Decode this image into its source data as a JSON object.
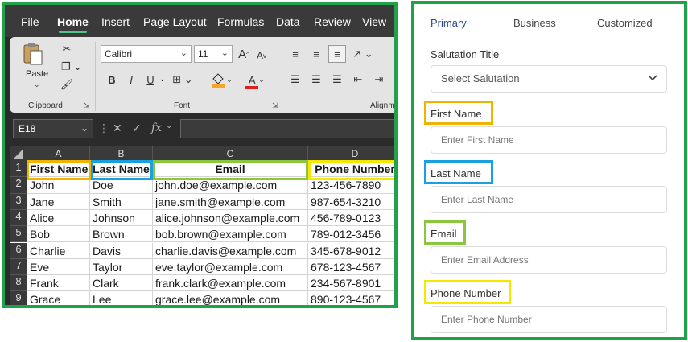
{
  "excel": {
    "menu": [
      "File",
      "Home",
      "Insert",
      "Page Layout",
      "Formulas",
      "Data",
      "Review",
      "View"
    ],
    "active_menu": "Home",
    "ribbon": {
      "paste_label": "Paste",
      "clipboard_label": "Clipboard",
      "font_name": "Calibri",
      "font_size": "11",
      "font_group_label": "Font",
      "alignment_label": "Alignme",
      "bold": "B",
      "italic": "I",
      "underline": "U",
      "grow_font": "A",
      "shrink_font": "A",
      "font_color_letter": "A"
    },
    "name_box": "E18",
    "formula_icons": {
      "cancel": "✕",
      "confirm": "✓",
      "fx": "fx"
    },
    "columns": [
      "A",
      "B",
      "C",
      "D"
    ],
    "rows": [
      "1",
      "2",
      "3",
      "4",
      "5",
      "6",
      "7",
      "8",
      "9"
    ],
    "header": [
      "First Name",
      "Last Name",
      "Email",
      "Phone Number"
    ],
    "data": [
      [
        "John",
        "Doe",
        "john.doe@example.com",
        "123-456-7890"
      ],
      [
        "Jane",
        "Smith",
        "jane.smith@example.com",
        "987-654-3210"
      ],
      [
        "Alice",
        "Johnson",
        "alice.johnson@example.com",
        "456-789-0123"
      ],
      [
        "Bob",
        "Brown",
        "bob.brown@example.com",
        "789-012-3456"
      ],
      [
        "Charlie",
        "Davis",
        "charlie.davis@example.com",
        "345-678-9012"
      ],
      [
        "Eve",
        "Taylor",
        "eve.taylor@example.com",
        "678-123-4567"
      ],
      [
        "Frank",
        "Clark",
        "frank.clark@example.com",
        "234-567-8901"
      ],
      [
        "Grace",
        "Lee",
        "grace.lee@example.com",
        "890-123-4567"
      ]
    ]
  },
  "form": {
    "tabs": [
      "Primary",
      "Business",
      "Customized"
    ],
    "active_tab": "Primary",
    "salutation": {
      "label": "Salutation Title",
      "placeholder": "Select Salutation"
    },
    "first_name": {
      "label": "First Name",
      "placeholder": "Enter First Name"
    },
    "last_name": {
      "label": "Last Name",
      "placeholder": "Enter Last Name"
    },
    "email": {
      "label": "Email",
      "placeholder": "Enter Email Address"
    },
    "phone": {
      "label": "Phone Number",
      "placeholder": "Enter Phone Number"
    }
  },
  "colors": {
    "frame_green": "#1fa24a",
    "first_name": "#f0b400",
    "last_name": "#1a9fe0",
    "email": "#8cc63f",
    "phone": "#f5e800",
    "active_tab": "#2c4a8a"
  },
  "icons": [
    "paste-icon",
    "cut-icon",
    "copy-icon",
    "format-painter-icon",
    "borders-icon",
    "fill-color-icon",
    "font-color-icon",
    "align-icons",
    "wrap-icon",
    "chevron-down-icon"
  ]
}
